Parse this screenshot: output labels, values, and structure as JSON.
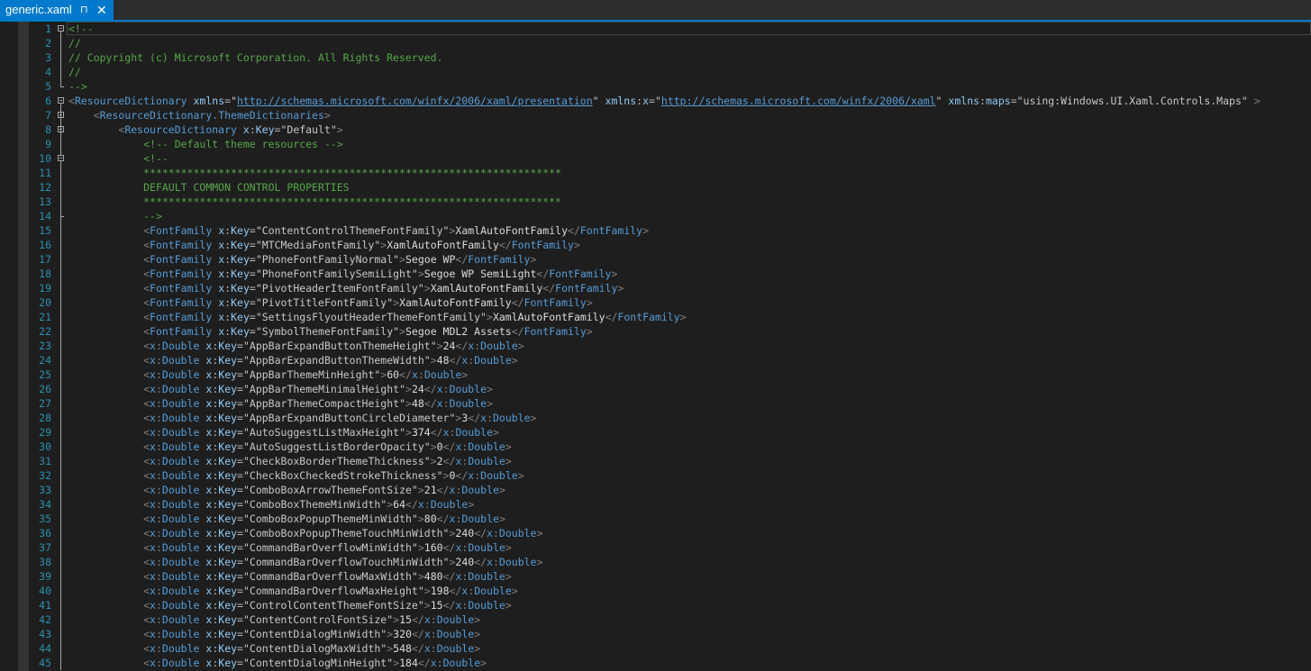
{
  "tab": {
    "title": "generic.xaml",
    "pin_glyph": "⊓",
    "close_glyph": "✕"
  },
  "colors": {
    "accent": "#007acc",
    "background": "#1e1e1e",
    "line_number": "#2b91af",
    "comment": "#57a64a",
    "tag": "#569cd6",
    "attribute": "#9cdcfe",
    "text": "#dcdcdc"
  },
  "lines": [
    {
      "n": "1",
      "tokens": [
        {
          "c": "c-comment",
          "t": "<!--"
        }
      ]
    },
    {
      "n": "2",
      "tokens": [
        {
          "c": "c-comment",
          "t": "//"
        }
      ]
    },
    {
      "n": "3",
      "tokens": [
        {
          "c": "c-comment",
          "t": "// Copyright (c) Microsoft Corporation. All Rights Reserved."
        }
      ]
    },
    {
      "n": "4",
      "tokens": [
        {
          "c": "c-comment",
          "t": "//"
        }
      ]
    },
    {
      "n": "5",
      "tokens": [
        {
          "c": "c-comment",
          "t": "-->"
        }
      ]
    },
    {
      "n": "6",
      "tokens": [
        {
          "c": "c-bracket",
          "t": "<"
        },
        {
          "c": "c-tag",
          "t": "ResourceDictionary"
        },
        {
          "c": "t-def",
          "t": " "
        },
        {
          "c": "c-attrname",
          "t": "xmlns"
        },
        {
          "c": "c-eq",
          "t": "="
        },
        {
          "c": "c-q",
          "t": "\""
        },
        {
          "c": "c-link",
          "t": "http://schemas.microsoft.com/winfx/2006/xaml/presentation"
        },
        {
          "c": "c-q",
          "t": "\""
        },
        {
          "c": "t-def",
          "t": " "
        },
        {
          "c": "c-attrname",
          "t": "xmlns"
        },
        {
          "c": "c-eq",
          "t": ":"
        },
        {
          "c": "c-attrname",
          "t": "x"
        },
        {
          "c": "c-eq",
          "t": "="
        },
        {
          "c": "c-q",
          "t": "\""
        },
        {
          "c": "c-link",
          "t": "http://schemas.microsoft.com/winfx/2006/xaml"
        },
        {
          "c": "c-q",
          "t": "\""
        },
        {
          "c": "t-def",
          "t": " "
        },
        {
          "c": "c-attrname",
          "t": "xmlns"
        },
        {
          "c": "c-eq",
          "t": ":"
        },
        {
          "c": "c-attrname",
          "t": "maps"
        },
        {
          "c": "c-eq",
          "t": "="
        },
        {
          "c": "c-q",
          "t": "\"using:Windows.UI.Xaml.Controls.Maps\""
        },
        {
          "c": "t-def",
          "t": " "
        },
        {
          "c": "c-bracket",
          "t": ">"
        }
      ]
    },
    {
      "n": "7",
      "indent": "    ",
      "tokens": [
        {
          "c": "c-bracket",
          "t": "<"
        },
        {
          "c": "c-tag",
          "t": "ResourceDictionary.ThemeDictionaries"
        },
        {
          "c": "c-bracket",
          "t": ">"
        }
      ]
    },
    {
      "n": "8",
      "indent": "        ",
      "tokens": [
        {
          "c": "c-bracket",
          "t": "<"
        },
        {
          "c": "c-tag",
          "t": "ResourceDictionary"
        },
        {
          "c": "t-def",
          "t": " "
        },
        {
          "c": "c-attrname",
          "t": "x"
        },
        {
          "c": "c-eq",
          "t": ":"
        },
        {
          "c": "c-attrname",
          "t": "Key"
        },
        {
          "c": "c-eq",
          "t": "="
        },
        {
          "c": "c-q",
          "t": "\"Default\""
        },
        {
          "c": "c-bracket",
          "t": ">"
        }
      ]
    },
    {
      "n": "9",
      "indent": "            ",
      "tokens": [
        {
          "c": "c-comment",
          "t": "<!-- Default theme resources -->"
        }
      ]
    },
    {
      "n": "10",
      "indent": "            ",
      "tokens": [
        {
          "c": "c-comment",
          "t": "<!--"
        }
      ]
    },
    {
      "n": "11",
      "indent": "            ",
      "tokens": [
        {
          "c": "c-comment",
          "t": "*******************************************************************"
        }
      ]
    },
    {
      "n": "12",
      "indent": "            ",
      "tokens": [
        {
          "c": "c-comment",
          "t": "DEFAULT COMMON CONTROL PROPERTIES"
        }
      ]
    },
    {
      "n": "13",
      "indent": "            ",
      "tokens": [
        {
          "c": "c-comment",
          "t": "*******************************************************************"
        }
      ]
    },
    {
      "n": "14",
      "indent": "            ",
      "tokens": [
        {
          "c": "c-comment",
          "t": "-->"
        }
      ]
    },
    {
      "n": "15",
      "indent": "            ",
      "el": "FontFamily",
      "ns": "",
      "key": "ContentControlThemeFontFamily",
      "val": "XamlAutoFontFamily"
    },
    {
      "n": "16",
      "indent": "            ",
      "el": "FontFamily",
      "ns": "",
      "key": "MTCMediaFontFamily",
      "val": "XamlAutoFontFamily"
    },
    {
      "n": "17",
      "indent": "            ",
      "el": "FontFamily",
      "ns": "",
      "key": "PhoneFontFamilyNormal",
      "val": "Segoe WP"
    },
    {
      "n": "18",
      "indent": "            ",
      "el": "FontFamily",
      "ns": "",
      "key": "PhoneFontFamilySemiLight",
      "val": "Segoe WP SemiLight"
    },
    {
      "n": "19",
      "indent": "            ",
      "el": "FontFamily",
      "ns": "",
      "key": "PivotHeaderItemFontFamily",
      "val": "XamlAutoFontFamily"
    },
    {
      "n": "20",
      "indent": "            ",
      "el": "FontFamily",
      "ns": "",
      "key": "PivotTitleFontFamily",
      "val": "XamlAutoFontFamily"
    },
    {
      "n": "21",
      "indent": "            ",
      "el": "FontFamily",
      "ns": "",
      "key": "SettingsFlyoutHeaderThemeFontFamily",
      "val": "XamlAutoFontFamily"
    },
    {
      "n": "22",
      "indent": "            ",
      "el": "FontFamily",
      "ns": "",
      "key": "SymbolThemeFontFamily",
      "val": "Segoe MDL2 Assets"
    },
    {
      "n": "23",
      "indent": "            ",
      "el": "Double",
      "ns": "x",
      "key": "AppBarExpandButtonThemeHeight",
      "val": "24"
    },
    {
      "n": "24",
      "indent": "            ",
      "el": "Double",
      "ns": "x",
      "key": "AppBarExpandButtonThemeWidth",
      "val": "48"
    },
    {
      "n": "25",
      "indent": "            ",
      "el": "Double",
      "ns": "x",
      "key": "AppBarThemeMinHeight",
      "val": "60"
    },
    {
      "n": "26",
      "indent": "            ",
      "el": "Double",
      "ns": "x",
      "key": "AppBarThemeMinimalHeight",
      "val": "24"
    },
    {
      "n": "27",
      "indent": "            ",
      "el": "Double",
      "ns": "x",
      "key": "AppBarThemeCompactHeight",
      "val": "48"
    },
    {
      "n": "28",
      "indent": "            ",
      "el": "Double",
      "ns": "x",
      "key": "AppBarExpandButtonCircleDiameter",
      "val": "3"
    },
    {
      "n": "29",
      "indent": "            ",
      "el": "Double",
      "ns": "x",
      "key": "AutoSuggestListMaxHeight",
      "val": "374"
    },
    {
      "n": "30",
      "indent": "            ",
      "el": "Double",
      "ns": "x",
      "key": "AutoSuggestListBorderOpacity",
      "val": "0"
    },
    {
      "n": "31",
      "indent": "            ",
      "el": "Double",
      "ns": "x",
      "key": "CheckBoxBorderThemeThickness",
      "val": "2"
    },
    {
      "n": "32",
      "indent": "            ",
      "el": "Double",
      "ns": "x",
      "key": "CheckBoxCheckedStrokeThickness",
      "val": "0"
    },
    {
      "n": "33",
      "indent": "            ",
      "el": "Double",
      "ns": "x",
      "key": "ComboBoxArrowThemeFontSize",
      "val": "21"
    },
    {
      "n": "34",
      "indent": "            ",
      "el": "Double",
      "ns": "x",
      "key": "ComboBoxThemeMinWidth",
      "val": "64"
    },
    {
      "n": "35",
      "indent": "            ",
      "el": "Double",
      "ns": "x",
      "key": "ComboBoxPopupThemeMinWidth",
      "val": "80"
    },
    {
      "n": "36",
      "indent": "            ",
      "el": "Double",
      "ns": "x",
      "key": "ComboBoxPopupThemeTouchMinWidth",
      "val": "240"
    },
    {
      "n": "37",
      "indent": "            ",
      "el": "Double",
      "ns": "x",
      "key": "CommandBarOverflowMinWidth",
      "val": "160"
    },
    {
      "n": "38",
      "indent": "            ",
      "el": "Double",
      "ns": "x",
      "key": "CommandBarOverflowTouchMinWidth",
      "val": "240"
    },
    {
      "n": "39",
      "indent": "            ",
      "el": "Double",
      "ns": "x",
      "key": "CommandBarOverflowMaxWidth",
      "val": "480"
    },
    {
      "n": "40",
      "indent": "            ",
      "el": "Double",
      "ns": "x",
      "key": "CommandBarOverflowMaxHeight",
      "val": "198"
    },
    {
      "n": "41",
      "indent": "            ",
      "el": "Double",
      "ns": "x",
      "key": "ControlContentThemeFontSize",
      "val": "15"
    },
    {
      "n": "42",
      "indent": "            ",
      "el": "Double",
      "ns": "x",
      "key": "ContentControlFontSize",
      "val": "15"
    },
    {
      "n": "43",
      "indent": "            ",
      "el": "Double",
      "ns": "x",
      "key": "ContentDialogMinWidth",
      "val": "320"
    },
    {
      "n": "44",
      "indent": "            ",
      "el": "Double",
      "ns": "x",
      "key": "ContentDialogMaxWidth",
      "val": "548"
    },
    {
      "n": "45",
      "indent": "            ",
      "el": "Double",
      "ns": "x",
      "key": "ContentDialogMinHeight",
      "val": "184"
    }
  ]
}
